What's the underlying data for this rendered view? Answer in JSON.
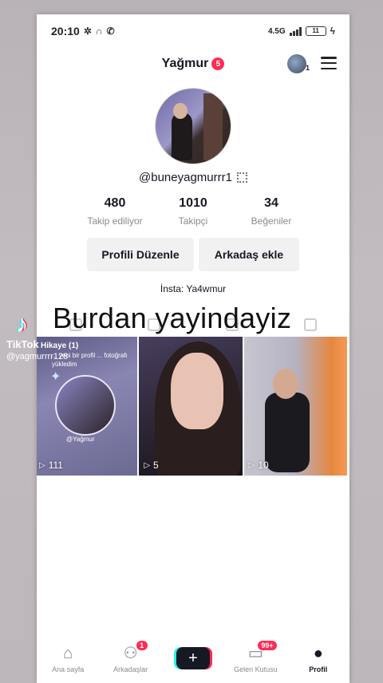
{
  "status": {
    "time": "20:10",
    "net": "4.5G",
    "battery": "11"
  },
  "header": {
    "username": "Yağmur",
    "notif_count": "5",
    "account_count": "1"
  },
  "profile": {
    "handle": "@buneyagmurrr1",
    "stats": [
      {
        "value": "480",
        "label": "Takip ediliyor"
      },
      {
        "value": "1010",
        "label": "Takipçi"
      },
      {
        "value": "34",
        "label": "Beğeniler"
      }
    ],
    "edit_label": "Profili Düzenle",
    "add_friend_label": "Arkadaş ekle",
    "bio": "İnsta: Ya4wmur"
  },
  "overlay": {
    "caption": "Burdan yayindayiz",
    "watermark_name": "TikTok",
    "watermark_user": "@yagmurrrr128"
  },
  "videos": [
    {
      "views": "111",
      "story_tag": "Hikaye (1)",
      "story_text": "... yeni bir profil ... fotoğrafı yükledim",
      "story_user": "@Yağmur"
    },
    {
      "views": "5"
    },
    {
      "views": "10"
    }
  ],
  "nav": {
    "home": "Ana sayfa",
    "friends": "Arkadaşlar",
    "friends_badge": "1",
    "create": "+",
    "inbox": "Gelen Kutusu",
    "inbox_badge": "99+",
    "profile": "Profil"
  },
  "icons": [
    "settings-icon",
    "headphones-icon",
    "phone-icon",
    "qr-code-icon",
    "menu-icon",
    "play-icon",
    "home-icon",
    "friends-icon",
    "inbox-icon",
    "profile-icon"
  ],
  "colors": {
    "accent": "#fe2c55",
    "cyan": "#25f4ee",
    "text": "#161823"
  }
}
